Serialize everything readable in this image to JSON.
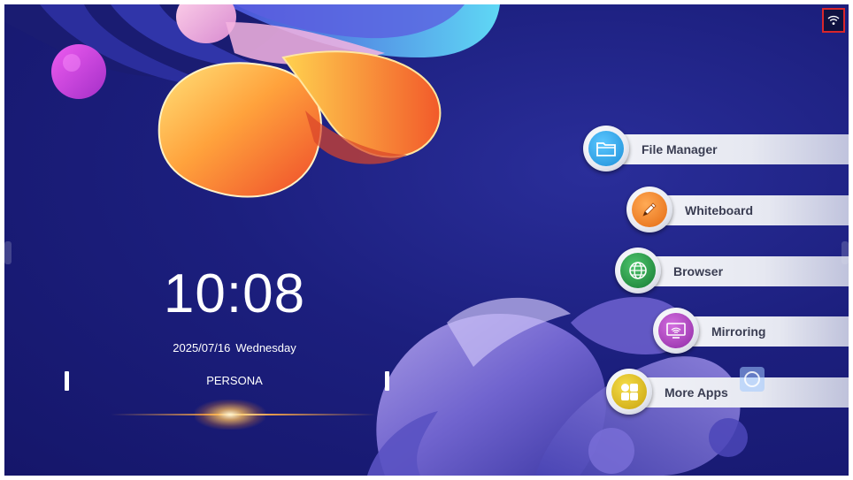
{
  "status_bar": {
    "wifi_icon": "wifi-icon"
  },
  "clock": {
    "time": "10:08",
    "date": "2025/07/16",
    "weekday": "Wednesday",
    "label": "PERSONA"
  },
  "apps": [
    {
      "label": "File Manager",
      "icon": "folder-icon",
      "color": "#1d9be0"
    },
    {
      "label": "Whiteboard",
      "icon": "pencil-icon",
      "color": "#ef7d1a"
    },
    {
      "label": "Browser",
      "icon": "globe-icon",
      "color": "#1f9a3f"
    },
    {
      "label": "Mirroring",
      "icon": "screen-cast-icon",
      "color": "#a83ab8"
    },
    {
      "label": "More Apps",
      "icon": "grid-icon",
      "color": "#d8b814"
    }
  ],
  "colors": {
    "background": "#1c1f7e",
    "wifi_highlight": "#d8262b"
  }
}
